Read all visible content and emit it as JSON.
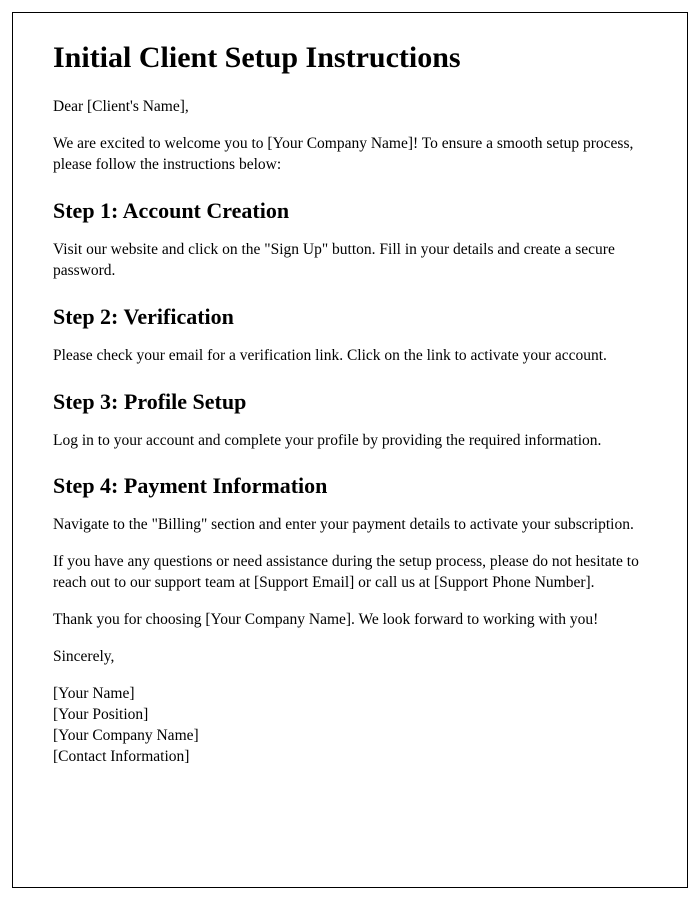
{
  "title": "Initial Client Setup Instructions",
  "greeting": "Dear [Client's Name],",
  "intro": "We are excited to welcome you to [Your Company Name]! To ensure a smooth setup process, please follow the instructions below:",
  "step1": {
    "heading": "Step 1: Account Creation",
    "body": "Visit our website and click on the \"Sign Up\" button. Fill in your details and create a secure password."
  },
  "step2": {
    "heading": "Step 2: Verification",
    "body": "Please check your email for a verification link. Click on the link to activate your account."
  },
  "step3": {
    "heading": "Step 3: Profile Setup",
    "body": "Log in to your account and complete your profile by providing the required information."
  },
  "step4": {
    "heading": "Step 4: Payment Information",
    "body": "Navigate to the \"Billing\" section and enter your payment details to activate your subscription."
  },
  "assistance": "If you have any questions or need assistance during the setup process, please do not hesitate to reach out to our support team at [Support Email] or call us at [Support Phone Number].",
  "thanks": "Thank you for choosing [Your Company Name]. We look forward to working with you!",
  "closing": "Sincerely,",
  "signature": {
    "name": "[Your Name]",
    "position": "[Your Position]",
    "company": "[Your Company Name]",
    "contact": "[Contact Information]"
  }
}
